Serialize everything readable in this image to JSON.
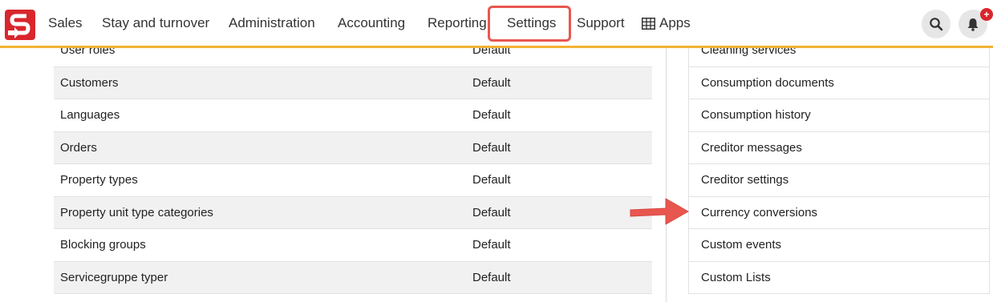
{
  "nav": {
    "items": [
      {
        "label": "Sales"
      },
      {
        "label": "Stay and turnover"
      },
      {
        "label": "Administration"
      },
      {
        "label": "Accounting"
      },
      {
        "label": "Reporting"
      },
      {
        "label": "Settings"
      },
      {
        "label": "Support"
      },
      {
        "label": "Apps"
      }
    ],
    "highlighted": "Settings",
    "highlight_color": "#e8574f",
    "accent_color": "#f2b233",
    "brand_color": "#d9262c",
    "notification_badge": "+"
  },
  "left_table": {
    "rows": [
      {
        "name": "User roles",
        "value": "Default"
      },
      {
        "name": "Customers",
        "value": "Default"
      },
      {
        "name": "Languages",
        "value": "Default"
      },
      {
        "name": "Orders",
        "value": "Default"
      },
      {
        "name": "Property types",
        "value": "Default"
      },
      {
        "name": "Property unit type categories",
        "value": "Default"
      },
      {
        "name": "Blocking groups",
        "value": "Default"
      },
      {
        "name": "Servicegruppe typer",
        "value": "Default"
      }
    ]
  },
  "right_list": {
    "items": [
      {
        "label": "Cleaning services"
      },
      {
        "label": "Consumption documents"
      },
      {
        "label": "Consumption history"
      },
      {
        "label": "Creditor messages"
      },
      {
        "label": "Creditor settings"
      },
      {
        "label": "Currency conversions"
      },
      {
        "label": "Custom events"
      },
      {
        "label": "Custom Lists"
      }
    ],
    "pointed_item": "Currency conversions",
    "arrow_color": "#e8574f"
  }
}
